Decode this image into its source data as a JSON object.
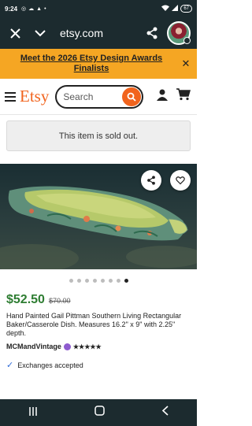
{
  "status_bar": {
    "time": "9:24",
    "battery": "67"
  },
  "browser": {
    "url": "etsy.com"
  },
  "banner": {
    "text": "Meet the 2026 Etsy Design Awards Finalists",
    "close": "✕"
  },
  "header": {
    "logo": "Etsy",
    "search_placeholder": "Search"
  },
  "listing": {
    "sold_out_text": "This item is sold out.",
    "image_count": 8,
    "active_image_index": 7,
    "price": "$52.50",
    "original_price": "$70.00",
    "title": "Hand Painted Gail Pittman Southern Living Rectangular Baker/Casserole Dish. Measures 16.2\" x 9\" with 2.25\" depth.",
    "shop_name": "MCMandVintage",
    "rating_stars": "★★★★★",
    "exchanges_text": "Exchanges accepted"
  },
  "colors": {
    "brand_orange": "#f1641e",
    "banner_bg": "#f5a623",
    "price_green": "#2e7d32",
    "star_seller_purple": "#8e5ccf",
    "system_bar": "#1c2b2f"
  }
}
